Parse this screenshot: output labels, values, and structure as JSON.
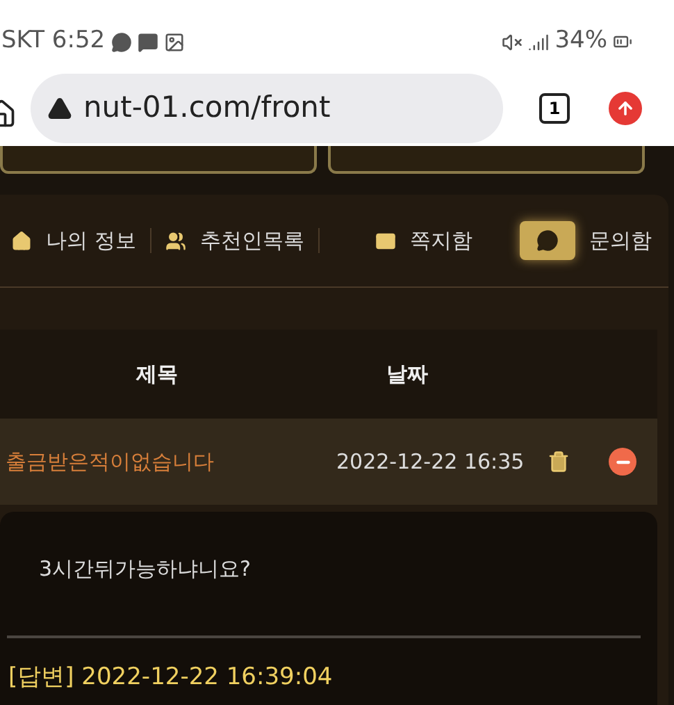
{
  "status_bar": {
    "carrier_time": "SKT 6:52",
    "battery": "34%"
  },
  "browser": {
    "url": "nut-01.com/front",
    "tab_count": "1"
  },
  "tabs": [
    {
      "label": "나의 정보",
      "selected": false
    },
    {
      "label": "추천인목록",
      "selected": false
    },
    {
      "label": "쪽지함",
      "selected": false
    },
    {
      "label": "문의함",
      "selected": true
    }
  ],
  "table": {
    "columns": [
      "제목",
      "날짜"
    ],
    "rows": [
      {
        "title": "출금받은적이없습니다",
        "date": "2022-12-22 16:35",
        "expanded": true
      }
    ]
  },
  "detail": {
    "question": "3시간뒤가능하냐니요?",
    "answer_header": "[답변] 2022-12-22 16:39:04"
  }
}
